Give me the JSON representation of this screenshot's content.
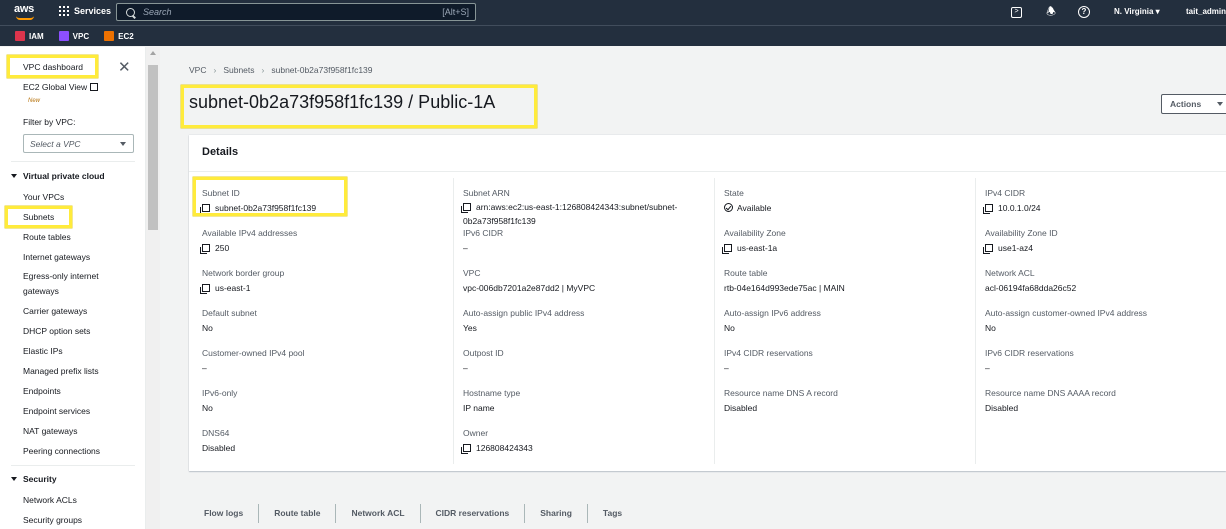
{
  "topnav": {
    "logo_text": "aws",
    "services_label": "Services",
    "search_placeholder": "Search",
    "search_shortcut": "[Alt+S]",
    "region": "N. Virginia ▾",
    "user": "tait_admin"
  },
  "favorites": [
    {
      "label": "IAM",
      "color": "#dd344c"
    },
    {
      "label": "VPC",
      "color": "#8c4fff"
    },
    {
      "label": "EC2",
      "color": "#ed7100"
    }
  ],
  "sidebar": {
    "vpc_dashboard": "VPC dashboard",
    "ec2_global_view": "EC2 Global View",
    "new_badge": "New",
    "filter_label": "Filter by VPC:",
    "filter_placeholder": "Select a VPC",
    "section_vpc": "Virtual private cloud",
    "items": [
      "Your VPCs",
      "Subnets",
      "Route tables",
      "Internet gateways",
      "Egress-only internet",
      "gateways",
      "Carrier gateways",
      "DHCP option sets",
      "Elastic IPs",
      "Managed prefix lists",
      "Endpoints",
      "Endpoint services",
      "NAT gateways",
      "Peering connections"
    ],
    "section_security": "Security",
    "security_items": [
      "Network ACLs",
      "Security groups"
    ]
  },
  "breadcrumb": [
    "VPC",
    "Subnets",
    "subnet-0b2a73f958f1fc139"
  ],
  "page_title": "subnet-0b2a73f958f1fc139 / Public-1A",
  "actions_label": "Actions",
  "details": {
    "title": "Details",
    "col1": [
      {
        "label": "Subnet ID",
        "value": "subnet-0b2a73f958f1fc139"
      },
      {
        "label": "Available IPv4 addresses",
        "value": "250"
      },
      {
        "label": "Network border group",
        "value": "us-east-1"
      },
      {
        "label": "Default subnet",
        "value": "No"
      },
      {
        "label": "Customer-owned IPv4 pool",
        "value": "–"
      },
      {
        "label": "IPv6-only",
        "value": "No"
      },
      {
        "label": "DNS64",
        "value": "Disabled"
      }
    ],
    "col2": [
      {
        "label": "Subnet ARN",
        "value": "arn:aws:ec2:us-east-1:126808424343:subnet/subnet-0b2a73f958f1fc139"
      },
      {
        "label": "IPv6 CIDR",
        "value": "–"
      },
      {
        "label": "VPC",
        "value": "vpc-006db7201a2e87dd2 | MyVPC"
      },
      {
        "label": "Auto-assign public IPv4 address",
        "value": "Yes"
      },
      {
        "label": "Outpost ID",
        "value": "–"
      },
      {
        "label": "Hostname type",
        "value": "IP name"
      },
      {
        "label": "Owner",
        "value": "126808424343"
      }
    ],
    "col3": [
      {
        "label": "State",
        "value": "Available"
      },
      {
        "label": "Availability Zone",
        "value": "us-east-1a"
      },
      {
        "label": "Route table",
        "value": "rtb-04e164d993ede75ac | MAIN"
      },
      {
        "label": "Auto-assign IPv6 address",
        "value": "No"
      },
      {
        "label": "IPv4 CIDR reservations",
        "value": "–"
      },
      {
        "label": "Resource name DNS A record",
        "value": "Disabled"
      }
    ],
    "col4": [
      {
        "label": "IPv4 CIDR",
        "value": "10.0.1.0/24"
      },
      {
        "label": "Availability Zone ID",
        "value": "use1-az4"
      },
      {
        "label": "Network ACL",
        "value": "acl-06194fa68dda26c52"
      },
      {
        "label": "Auto-assign customer-owned IPv4 address",
        "value": "No"
      },
      {
        "label": "IPv6 CIDR reservations",
        "value": "–"
      },
      {
        "label": "Resource name DNS AAAA record",
        "value": "Disabled"
      }
    ]
  },
  "tabs": [
    "Flow logs",
    "Route table",
    "Network ACL",
    "CIDR reservations",
    "Sharing",
    "Tags"
  ]
}
